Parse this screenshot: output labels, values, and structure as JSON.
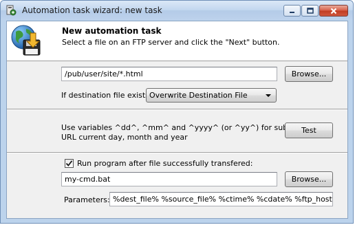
{
  "window": {
    "title": "Automation task wizard: new task",
    "controls": {
      "minimize_icon": "minimize-icon",
      "maximize_icon": "maximize-icon",
      "close_icon": "close-icon"
    }
  },
  "header": {
    "title": "New automation task",
    "subtitle": "Select a file on an FTP server and click the \"Next\" button.",
    "icon": "globe-disk-download-icon"
  },
  "source": {
    "path_value": "/pub/user/site/*.html",
    "browse_label": "Browse..."
  },
  "destination": {
    "label": "If destination file exists:",
    "selected": "Overwrite Destination File"
  },
  "variables": {
    "line1": "Use variables ^dd^, ^mm^ and ^yyyy^ (or ^yy^) for substitution in",
    "line2": "URL current day, month and year",
    "test_label": "Test"
  },
  "run_program": {
    "checked": true,
    "label": "Run program after file successfully transfered:",
    "program_value": "my-cmd.bat",
    "browse_label": "Browse...",
    "params_label": "Parameters:",
    "params_value": "%dest_file% %source_file% %ctime% %cdate% %ftp_host%"
  }
}
